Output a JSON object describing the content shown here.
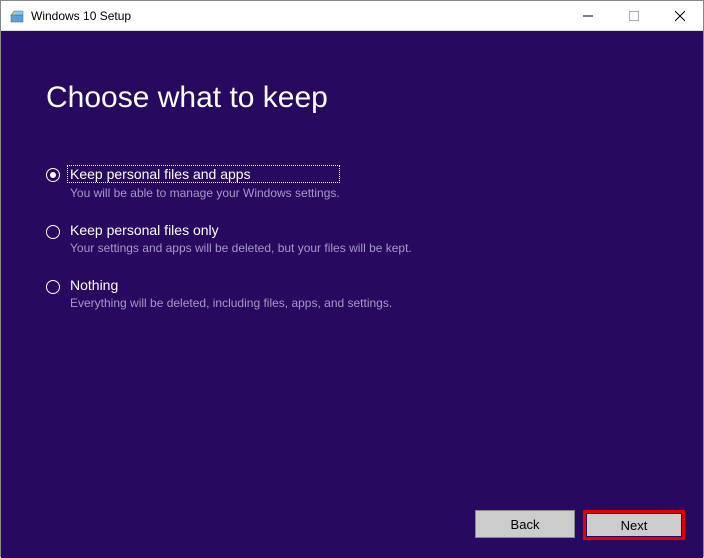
{
  "window": {
    "title": "Windows 10 Setup"
  },
  "heading": "Choose what to keep",
  "options": [
    {
      "label": "Keep personal files and apps",
      "description": "You will be able to manage your Windows settings.",
      "selected": true
    },
    {
      "label": "Keep personal files only",
      "description": "Your settings and apps will be deleted, but your files will be kept.",
      "selected": false
    },
    {
      "label": "Nothing",
      "description": "Everything will be deleted, including files, apps, and settings.",
      "selected": false
    }
  ],
  "buttons": {
    "back": "Back",
    "next": "Next"
  }
}
